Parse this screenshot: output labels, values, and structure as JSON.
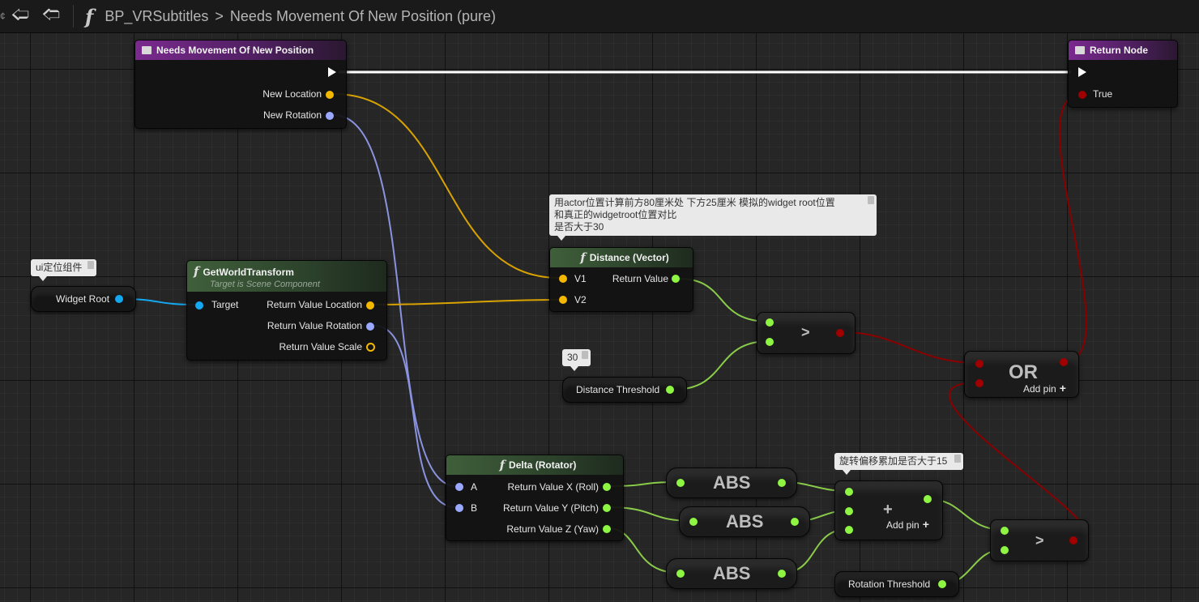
{
  "toolbar": {
    "back_icon": "back-arrow-icon",
    "forward_icon": "forward-arrow-icon",
    "function_icon": "function-icon",
    "function_glyph": "f",
    "breadcrumb": [
      "BP_VRSubtitles",
      "Needs Movement Of New Position (pure)"
    ],
    "breadcrumb_separator": ">"
  },
  "nodes": {
    "entry": {
      "title": "Needs Movement Of New Position",
      "outputs": [
        "New Location",
        "New Rotation"
      ]
    },
    "return_node": {
      "title": "Return Node",
      "inputs": [
        "True"
      ]
    },
    "widget_root": {
      "label": "Widget Root",
      "comment": "ui定位组件"
    },
    "get_world_transform": {
      "title": "GetWorldTransform",
      "subtitle": "Target is Scene Component",
      "inputs": [
        "Target"
      ],
      "outputs": [
        "Return Value Location",
        "Return Value Rotation",
        "Return Value Scale"
      ]
    },
    "distance": {
      "title": "Distance (Vector)",
      "inputs": [
        "V1",
        "V2"
      ],
      "outputs": [
        "Return Value"
      ],
      "comment_lines": [
        "用actor位置计算前方80厘米处 下方25厘米 模拟的widget root位置",
        "和真正的widgetroot位置对比",
        "是否大于30"
      ]
    },
    "greater_1": {
      "symbol": ">"
    },
    "distance_threshold": {
      "label": "Distance Threshold",
      "comment": "30"
    },
    "or_node": {
      "symbol": "OR",
      "add_pin": "Add pin"
    },
    "delta": {
      "title": "Delta (Rotator)",
      "inputs": [
        "A",
        "B"
      ],
      "outputs": [
        "Return Value X (Roll)",
        "Return Value Y (Pitch)",
        "Return Value Z (Yaw)"
      ]
    },
    "abs": {
      "symbol": "ABS"
    },
    "add_node": {
      "symbol": "+",
      "add_pin": "Add pin",
      "comment": "旋转偏移累加是否大于15"
    },
    "greater_2": {
      "symbol": ">"
    },
    "rotation_threshold": {
      "label": "Rotation Threshold"
    }
  },
  "colors": {
    "exec": "#ffffff",
    "vector": "#f5b800",
    "rotator": "#9aa8ff",
    "object": "#14a8f0",
    "float": "#8ef542",
    "bool": "#a00000"
  }
}
